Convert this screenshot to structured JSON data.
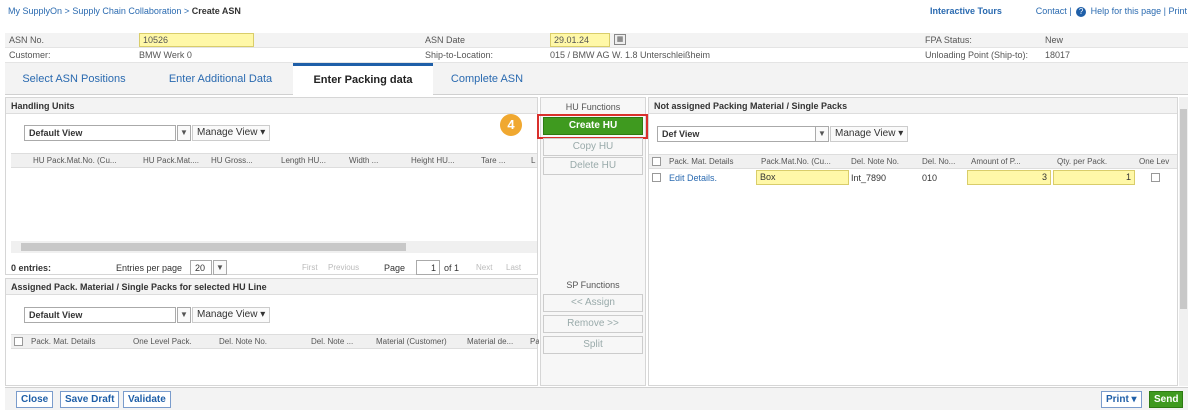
{
  "breadcrumb": {
    "part1": "My SupplyOn",
    "sep": ">",
    "part2": "Supply Chain Collaboration",
    "part3": "Create ASN"
  },
  "toplinks": {
    "tours": "Interactive Tours",
    "contact": "Contact |",
    "help": "Help for this page",
    "print": "| Print"
  },
  "header": {
    "asn_no_label": "ASN No.",
    "asn_no": "10526",
    "asn_date_label": "ASN Date",
    "asn_date": "29.01.24",
    "fpa_label": "FPA Status:",
    "fpa": "New",
    "customer_label": "Customer:",
    "customer": "BMW Werk 0",
    "ship_label": "Ship-to-Location:",
    "ship": "015 / BMW AG W. 1.8 Unterschleißheim",
    "unload_label": "Unloading Point (Ship-to):",
    "unload": "18017"
  },
  "tabs": [
    "Select ASN Positions",
    "Enter Additional Data",
    "Enter Packing data",
    "Complete ASN"
  ],
  "hu_panel": {
    "title": "Handling Units",
    "view": "Default View",
    "manage": "Manage View",
    "columns": [
      "HU Pack.Mat.No. (Cu...",
      "HU Pack.Mat....",
      "HU Gross...",
      "Length HU...",
      "Width ...",
      "Height HU...",
      "Tare ...",
      "L"
    ],
    "entries": "0 entries:",
    "per_page_label": "Entries per page",
    "per_page": "20",
    "first": "First",
    "previous": "Previous",
    "page_label": "Page",
    "page": "1",
    "of": "of 1",
    "next": "Next",
    "last": "Last"
  },
  "assigned_panel": {
    "title": "Assigned Pack. Material / Single Packs for selected HU Line",
    "view": "Default View",
    "manage": "Manage View",
    "columns": [
      "Pack. Mat. Details",
      "One Level Pack.",
      "Del. Note No.",
      "Del. Note ...",
      "Material (Customer)",
      "Material de...",
      "Pa"
    ]
  },
  "hu_functions": {
    "title": "HU Functions",
    "create": "Create HU",
    "copy": "Copy HU",
    "delete": "Delete HU",
    "step": "4"
  },
  "sp_functions": {
    "title": "SP Functions",
    "assign": "<< Assign",
    "remove": "Remove >>",
    "split": "Split"
  },
  "not_assigned": {
    "title": "Not assigned Packing Material / Single Packs",
    "view": "Def View",
    "manage": "Manage View",
    "columns": [
      "Pack. Mat. Details",
      "Pack.Mat.No. (Cu...",
      "Del. Note No.",
      "Del. No...",
      "Amount of P...",
      "Qty. per Pack.",
      "One Lev"
    ],
    "rows": [
      {
        "details": "Edit Details.",
        "pack": "Box",
        "note": "Int_7890",
        "del": "010",
        "amount": "3",
        "qty": "1"
      }
    ]
  },
  "footer": {
    "close": "Close",
    "save": "Save Draft",
    "validate": "Validate",
    "print": "Print",
    "send": "Send"
  },
  "colors": {
    "accent": "#1f5fa8",
    "green": "#3f9a1f",
    "highlight": "#fff8a8",
    "callout": "#f0a830",
    "redbox": "#d9302c"
  }
}
